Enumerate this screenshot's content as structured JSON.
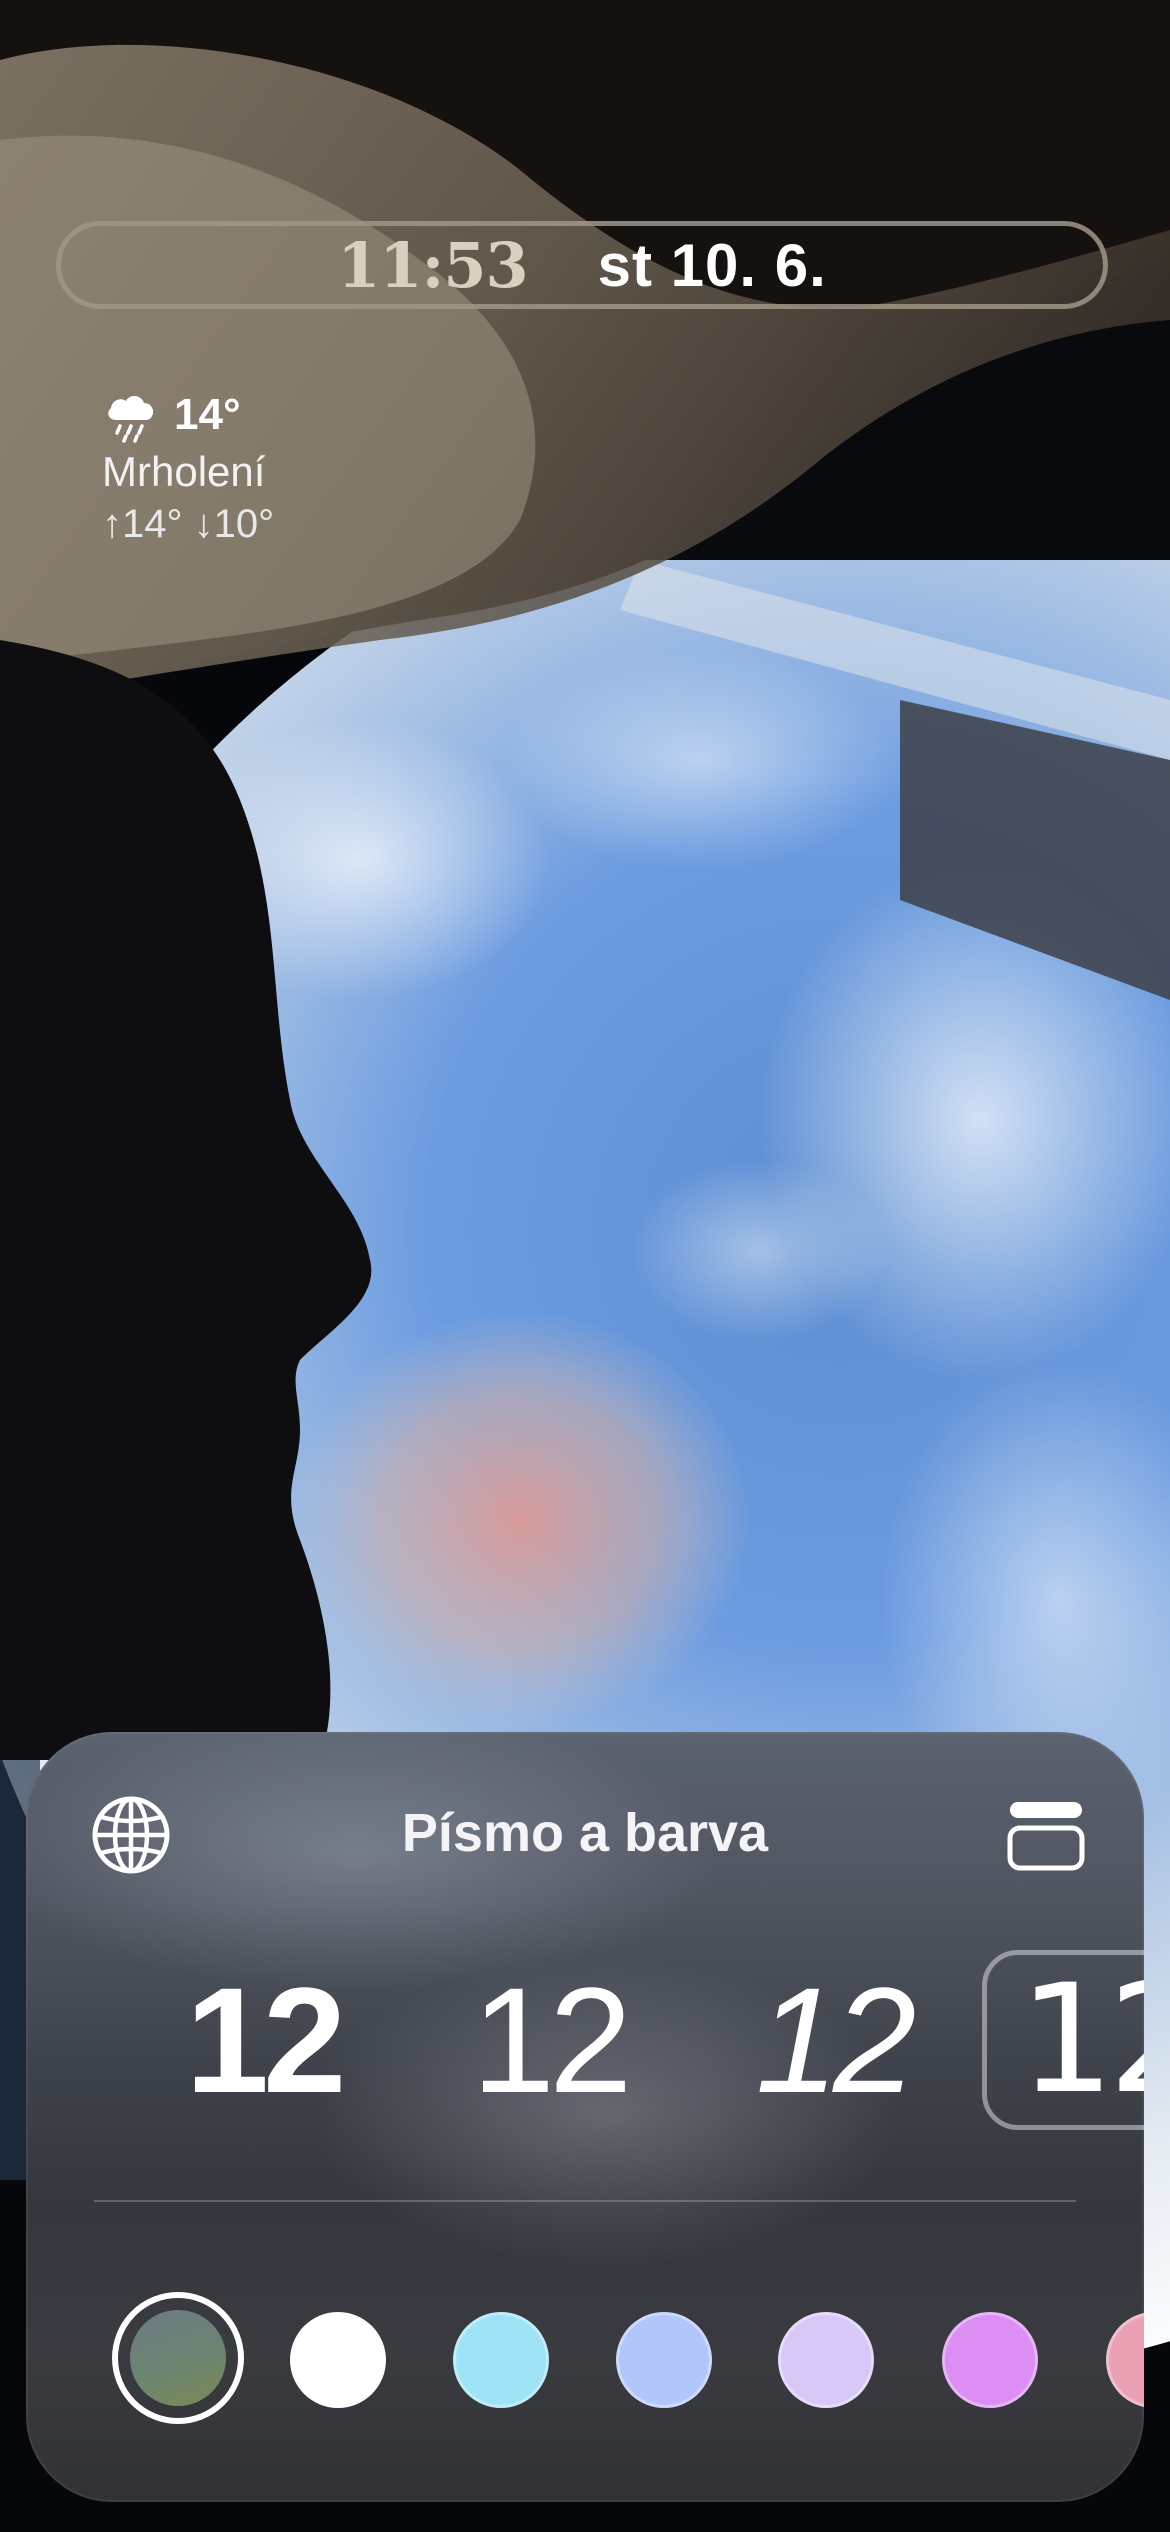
{
  "lock_screen": {
    "time": "11:53",
    "date": "st 10. 6."
  },
  "weather": {
    "icon": "cloud-drizzle-icon",
    "temperature": "14°",
    "condition": "Mrholení",
    "range": "↑14° ↓10°"
  },
  "customize_sheet": {
    "title": "Písmo a barva",
    "left_icon": "globe-icon",
    "right_icon": "widget-layout-icon",
    "font_options": [
      {
        "sample": "12",
        "selected": false
      },
      {
        "sample": "12",
        "selected": false
      },
      {
        "sample": "12",
        "selected": false
      },
      {
        "sample": "12",
        "selected": true
      }
    ],
    "color_options": [
      {
        "color": "#6e8275",
        "selected": true
      },
      {
        "color": "#ffffff",
        "selected": false
      },
      {
        "color": "#9fe3f7",
        "selected": false
      },
      {
        "color": "#b3c6fb",
        "selected": false
      },
      {
        "color": "#d8c8f8",
        "selected": false
      },
      {
        "color": "#dc8ef3",
        "selected": false
      },
      {
        "color": "#eaa1b4",
        "selected": false
      }
    ]
  }
}
